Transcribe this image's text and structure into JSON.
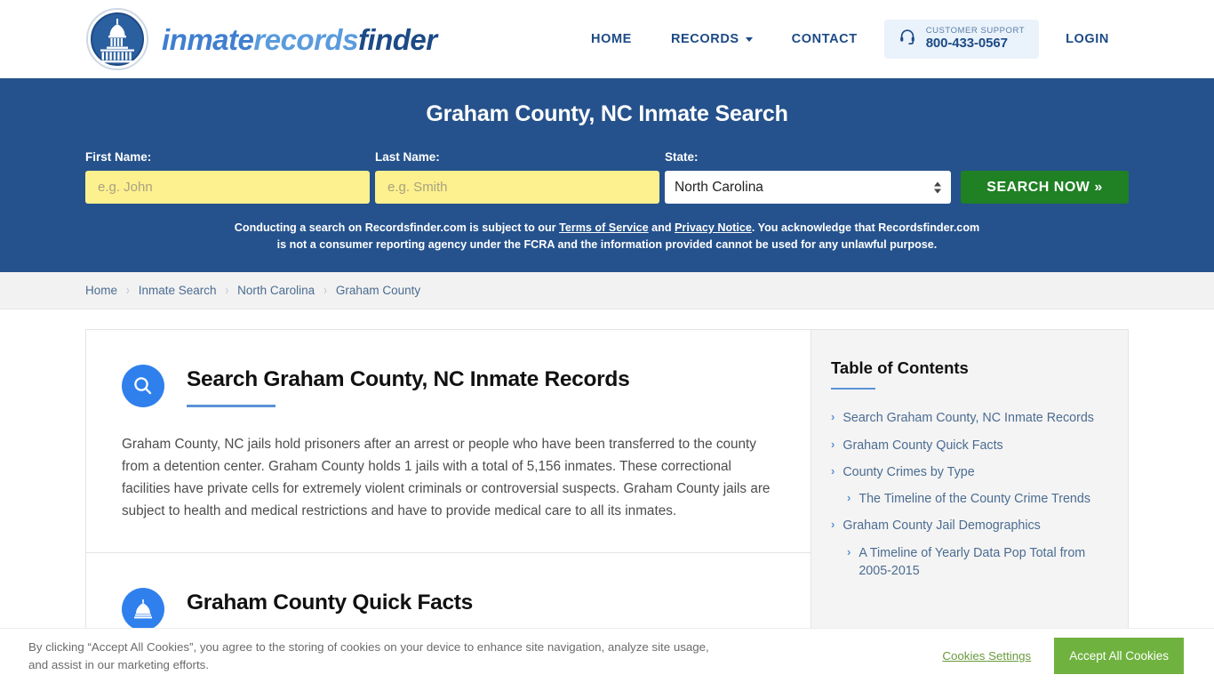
{
  "brand": {
    "word_1": "inmate",
    "word_2": "records",
    "word_3": "finder",
    "seal_alt": "capitol-building-seal"
  },
  "nav": {
    "items": [
      {
        "label": "HOME",
        "has_caret": false
      },
      {
        "label": "RECORDS",
        "has_caret": true
      },
      {
        "label": "CONTACT",
        "has_caret": false
      }
    ],
    "support": {
      "label": "CUSTOMER SUPPORT",
      "phone": "800-433-0567"
    },
    "login": "LOGIN"
  },
  "hero": {
    "title": "Graham County, NC Inmate Search",
    "first_name_label": "First Name:",
    "first_name_placeholder": "e.g. John",
    "first_name_value": "",
    "last_name_label": "Last Name:",
    "last_name_placeholder": "e.g. Smith",
    "last_name_value": "",
    "state_label": "State:",
    "state_value": "North Carolina",
    "search_button": "SEARCH NOW »",
    "disclaimer_part1": "Conducting a search on Recordsfinder.com is subject to our ",
    "disclaimer_link1": "Terms of Service",
    "disclaimer_part2": " and ",
    "disclaimer_link2": "Privacy Notice",
    "disclaimer_part3": ". You acknowledge that Recordsfinder.com is not a consumer reporting agency under the FCRA and the information provided cannot be used for any unlawful purpose.",
    "bg_color": "#25528c",
    "input_color": "#fdf08e",
    "button_color": "#1f8024"
  },
  "breadcrumb": {
    "separator": "›",
    "items": [
      "Home",
      "Inmate Search",
      "North Carolina",
      "Graham County"
    ]
  },
  "main": {
    "sections": [
      {
        "icon": "magnifying-glass-icon",
        "title": "Search Graham County, NC Inmate Records",
        "body": "Graham County, NC jails hold prisoners after an arrest or people who have been transferred to the county from a detention center. Graham County holds 1 jails with a total of 5,156 inmates. These correctional facilities have private cells for extremely violent criminals or controversial suspects. Graham County jails are subject to health and medical restrictions and have to provide medical care to all its inmates."
      },
      {
        "icon": "capitol-dome-icon",
        "title": "Graham County Quick Facts",
        "body": ""
      }
    ]
  },
  "sidebar": {
    "title": "Table of Contents",
    "chevron": "›",
    "items": [
      {
        "label": "Search Graham County, NC Inmate Records",
        "level": 1
      },
      {
        "label": "Graham County Quick Facts",
        "level": 1
      },
      {
        "label": "County Crimes by Type",
        "level": 1
      },
      {
        "label": "The Timeline of the County Crime Trends",
        "level": 2
      },
      {
        "label": "Graham County Jail Demographics",
        "level": 1
      },
      {
        "label": "A Timeline of Yearly Data Pop Total from 2005-2015",
        "level": 2
      }
    ]
  },
  "cookie_banner": {
    "text": "By clicking “Accept All Cookies”, you agree to the storing of cookies on your device to enhance site navigation, analyze site usage, and assist in our marketing efforts.",
    "settings_label": "Cookies Settings",
    "accept_label": "Accept All Cookies",
    "accept_color": "#70b23f"
  }
}
